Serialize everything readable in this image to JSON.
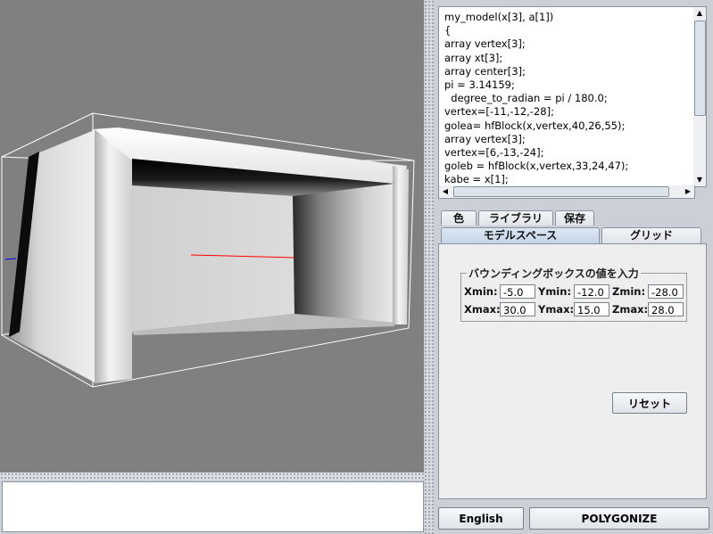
{
  "editor": {
    "code_lines": [
      "my_model(x[3], a[1])",
      "{",
      "array vertex[3];",
      "array xt[3];",
      "array center[3];",
      "pi = 3.14159;",
      "  degree_to_radian = pi / 180.0;",
      "vertex=[-11,-12,-28];",
      "golea= hfBlock(x,vertex,40,26,55);",
      "array vertex[3];",
      "vertex=[6,-13,-24];",
      "goleb = hfBlock(x,vertex,33,24,47);",
      "kabe = x[1];"
    ]
  },
  "tabs_row1": [
    "色",
    "ライブラリ",
    "保存"
  ],
  "tabs_row2": [
    "モデルスペース",
    "グリッド"
  ],
  "bounding_box": {
    "legend": "バウンディングボックスの値を入力",
    "xmin_label": "Xmin:",
    "xmin_value": "-5.0",
    "ymin_label": "Ymin:",
    "ymin_value": "-12.0",
    "zmin_label": "Zmin:",
    "zmin_value": "-28.0",
    "xmax_label": "Xmax:",
    "xmax_value": "30.0",
    "ymax_label": "Ymax:",
    "ymax_value": "15.0",
    "zmax_label": "Zmax:",
    "zmax_value": "28.0"
  },
  "reset_label": "リセット",
  "buttons": {
    "english": "English",
    "polygonize": "POLYGONIZE"
  },
  "colors": {
    "viewport_bg": "#808080",
    "axis_x": "#ff0000",
    "axis_y": "#0000ff"
  }
}
